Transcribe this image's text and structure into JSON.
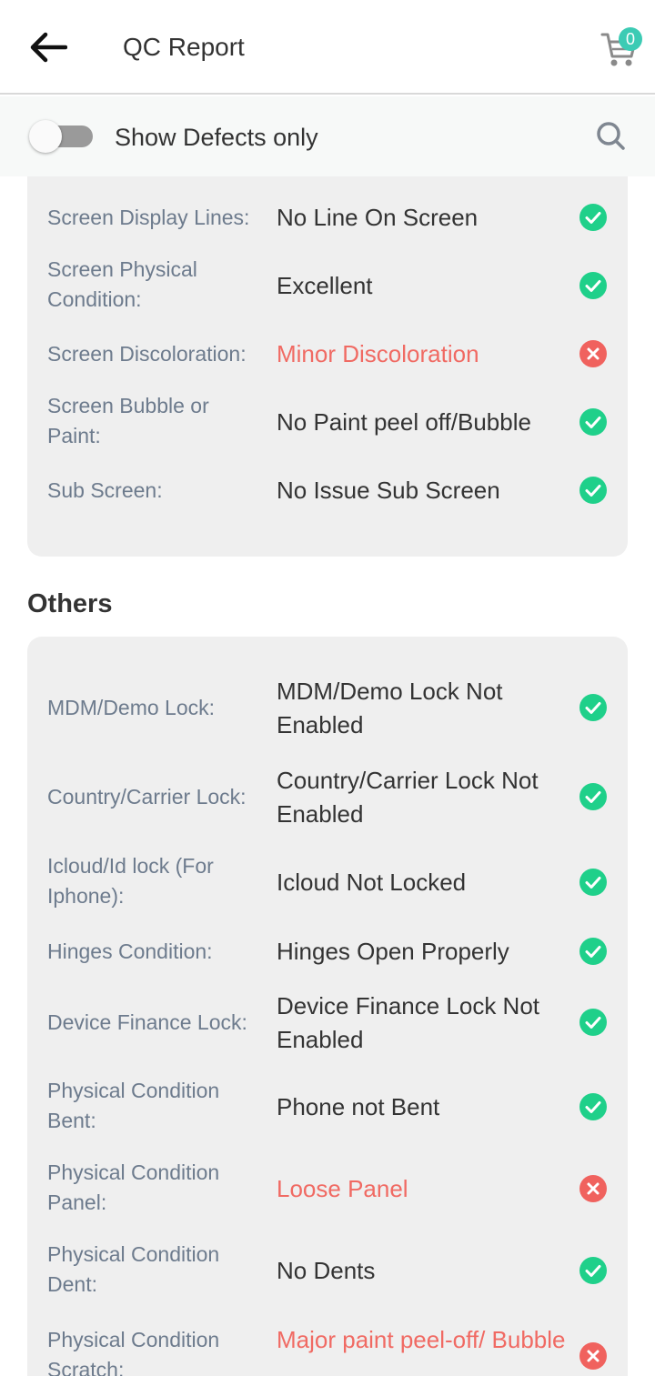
{
  "app_bar": {
    "title": "QC Report",
    "cart_count": "0"
  },
  "filter": {
    "label": "Show Defects only",
    "enabled": false
  },
  "colors": {
    "pass": "#1fd08a",
    "fail": "#f0625e",
    "defect_text": "#f06a63",
    "badge": "#3ccbb4"
  },
  "screen_rows": [
    {
      "label": "Screen Display Lines:",
      "value": "No Line On Screen",
      "status": "pass"
    },
    {
      "label": "Screen Physical Condition:",
      "value": "Excellent",
      "status": "pass"
    },
    {
      "label": "Screen Discoloration:",
      "value": "Minor Discoloration",
      "status": "fail"
    },
    {
      "label": "Screen Bubble or Paint:",
      "value": "No Paint peel off/Bubble",
      "status": "pass"
    },
    {
      "label": "Sub Screen:",
      "value": "No Issue Sub Screen",
      "status": "pass"
    }
  ],
  "others": {
    "title": "Others",
    "rows": [
      {
        "label": "MDM/Demo Lock:",
        "value": "MDM/Demo Lock Not Enabled",
        "status": "pass"
      },
      {
        "label": "Country/Carrier Lock:",
        "value": "Country/Carrier Lock Not Enabled",
        "status": "pass"
      },
      {
        "label": "Icloud/Id lock (For Iphone):",
        "value": "Icloud Not Locked",
        "status": "pass"
      },
      {
        "label": "Hinges Condition:",
        "value": "Hinges Open Properly",
        "status": "pass"
      },
      {
        "label": "Device Finance Lock:",
        "value": "Device Finance Lock Not Enabled",
        "status": "pass"
      },
      {
        "label": "Physical Condition Bent:",
        "value": "Phone not Bent",
        "status": "pass"
      },
      {
        "label": "Physical Condition Panel:",
        "value": "Loose Panel",
        "status": "fail"
      },
      {
        "label": "Physical Condition Dent:",
        "value": "No Dents",
        "status": "pass"
      },
      {
        "label": "Physical Condition Scratch:",
        "value": "Major paint peel-off/ Bubble",
        "status": "fail"
      }
    ]
  }
}
